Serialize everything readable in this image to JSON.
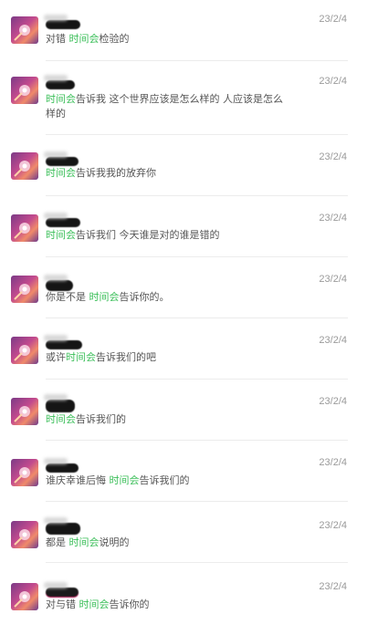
{
  "comments": [
    {
      "date": "23/2/4",
      "pre": "对错 ",
      "highlight": "时间会",
      "post": "检验的"
    },
    {
      "date": "23/2/4",
      "pre": "",
      "highlight": "时间会",
      "post": "告诉我 这个世界应该是怎么样的 人应该是怎么样的"
    },
    {
      "date": "23/2/4",
      "pre": "",
      "highlight": "时间会",
      "post": "告诉我我的放弃你"
    },
    {
      "date": "23/2/4",
      "pre": "",
      "highlight": "时间会",
      "post": "告诉我们 今天谁是对的谁是错的"
    },
    {
      "date": "23/2/4",
      "pre": "你是不是 ",
      "highlight": "时间会",
      "post": "告诉你的。"
    },
    {
      "date": "23/2/4",
      "pre": "或许",
      "highlight": "时间会",
      "post": "告诉我们的吧"
    },
    {
      "date": "23/2/4",
      "pre": "",
      "highlight": "时间会",
      "post": "告诉我们的"
    },
    {
      "date": "23/2/4",
      "pre": "谁庆幸谁后悔 ",
      "highlight": "时间会",
      "post": "告诉我们的"
    },
    {
      "date": "23/2/4",
      "pre": "都是 ",
      "highlight": "时间会",
      "post": "说明的"
    },
    {
      "date": "23/2/4",
      "pre": "对与错 ",
      "highlight": "时间会",
      "post": "告诉你的"
    }
  ],
  "colors": {
    "highlight": "#3cbf5a",
    "text": "#555555",
    "date": "#9a9a9a",
    "divider": "#ececec"
  }
}
